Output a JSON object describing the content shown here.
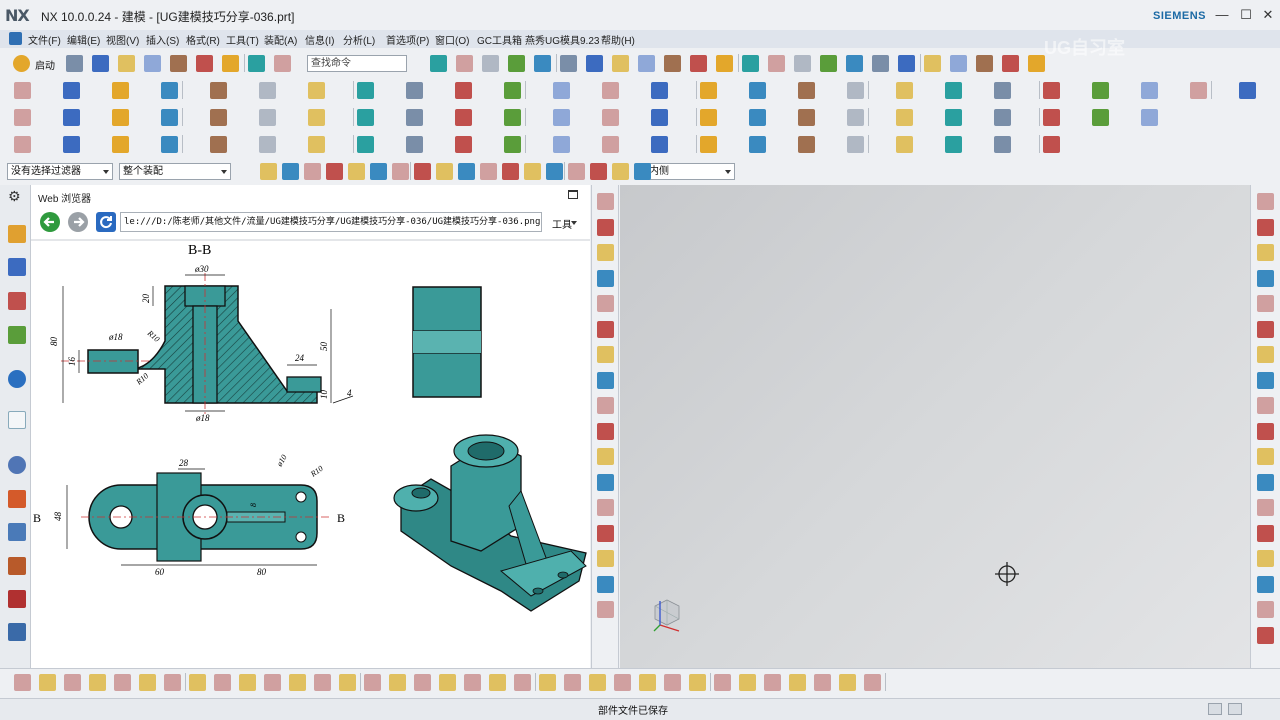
{
  "window": {
    "app_logo": "NX",
    "title": "NX 10.0.0.24 - 建模 - [UG建模技巧分享-036.prt]",
    "brand": "SIEMENS",
    "watermark": "UG自习室"
  },
  "menu": [
    "文件(F)",
    "编辑(E)",
    "视图(V)",
    "插入(S)",
    "格式(R)",
    "工具(T)",
    "装配(A)",
    "信息(I)",
    "分析(L)",
    "首选项(P)",
    "窗口(O)",
    "GC工具箱",
    "燕秀UG模具9.23",
    "帮助(H)"
  ],
  "toolbar": {
    "start_label": "启动",
    "search_placeholder": "查找命令",
    "filter_value": "没有选择过滤器",
    "scope_value": "整个装配",
    "side_value": "内侧"
  },
  "web_browser": {
    "title": "Web 浏览器",
    "url": "le:///D:/陈老师/其他文件/流量/UG建模技巧分享/UG建模技巧分享-036/UG建模技巧分享-036.png",
    "tools_label": "工具"
  },
  "drawing": {
    "section_title": "B-B",
    "section_marker": "B",
    "dims": {
      "d30": "ø30",
      "d18a": "ø18",
      "d18b": "ø18",
      "h20": "20",
      "h80": "80",
      "h16": "16",
      "h50": "50",
      "h10": "10",
      "w24": "24",
      "r10a": "R10",
      "r10b": "R10",
      "n4": "4",
      "w28": "28",
      "w48": "48",
      "w8": "8",
      "d10": "ø10",
      "r10c": "R10",
      "w60": "60",
      "w80": "80"
    }
  },
  "status": {
    "text": "部件文件已保存"
  },
  "colors": {
    "model_teal": "#3a9a98",
    "model_dark": "#1f6b6a",
    "viewport_gray": "#d2d4d6"
  }
}
